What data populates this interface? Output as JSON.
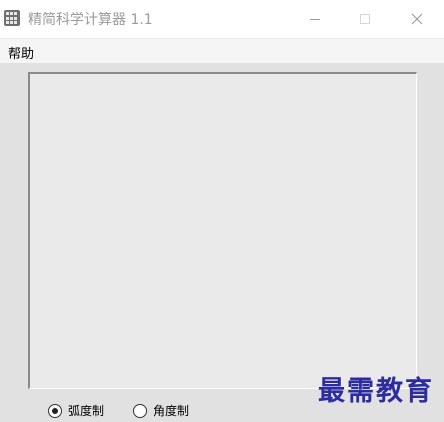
{
  "window": {
    "title": "精简科学计算器 1.1",
    "app_icon": "calculator-icon"
  },
  "controls": {
    "minimize_icon": "minimize-icon",
    "maximize_icon": "maximize-icon",
    "close_icon": "close-icon"
  },
  "menu": {
    "items": [
      {
        "label": "帮助"
      }
    ]
  },
  "display": {
    "value": ""
  },
  "angle_mode": {
    "options": [
      {
        "label": "弧度制",
        "selected": true
      },
      {
        "label": "角度制",
        "selected": false
      }
    ]
  },
  "watermark": {
    "text": "最需教育"
  }
}
